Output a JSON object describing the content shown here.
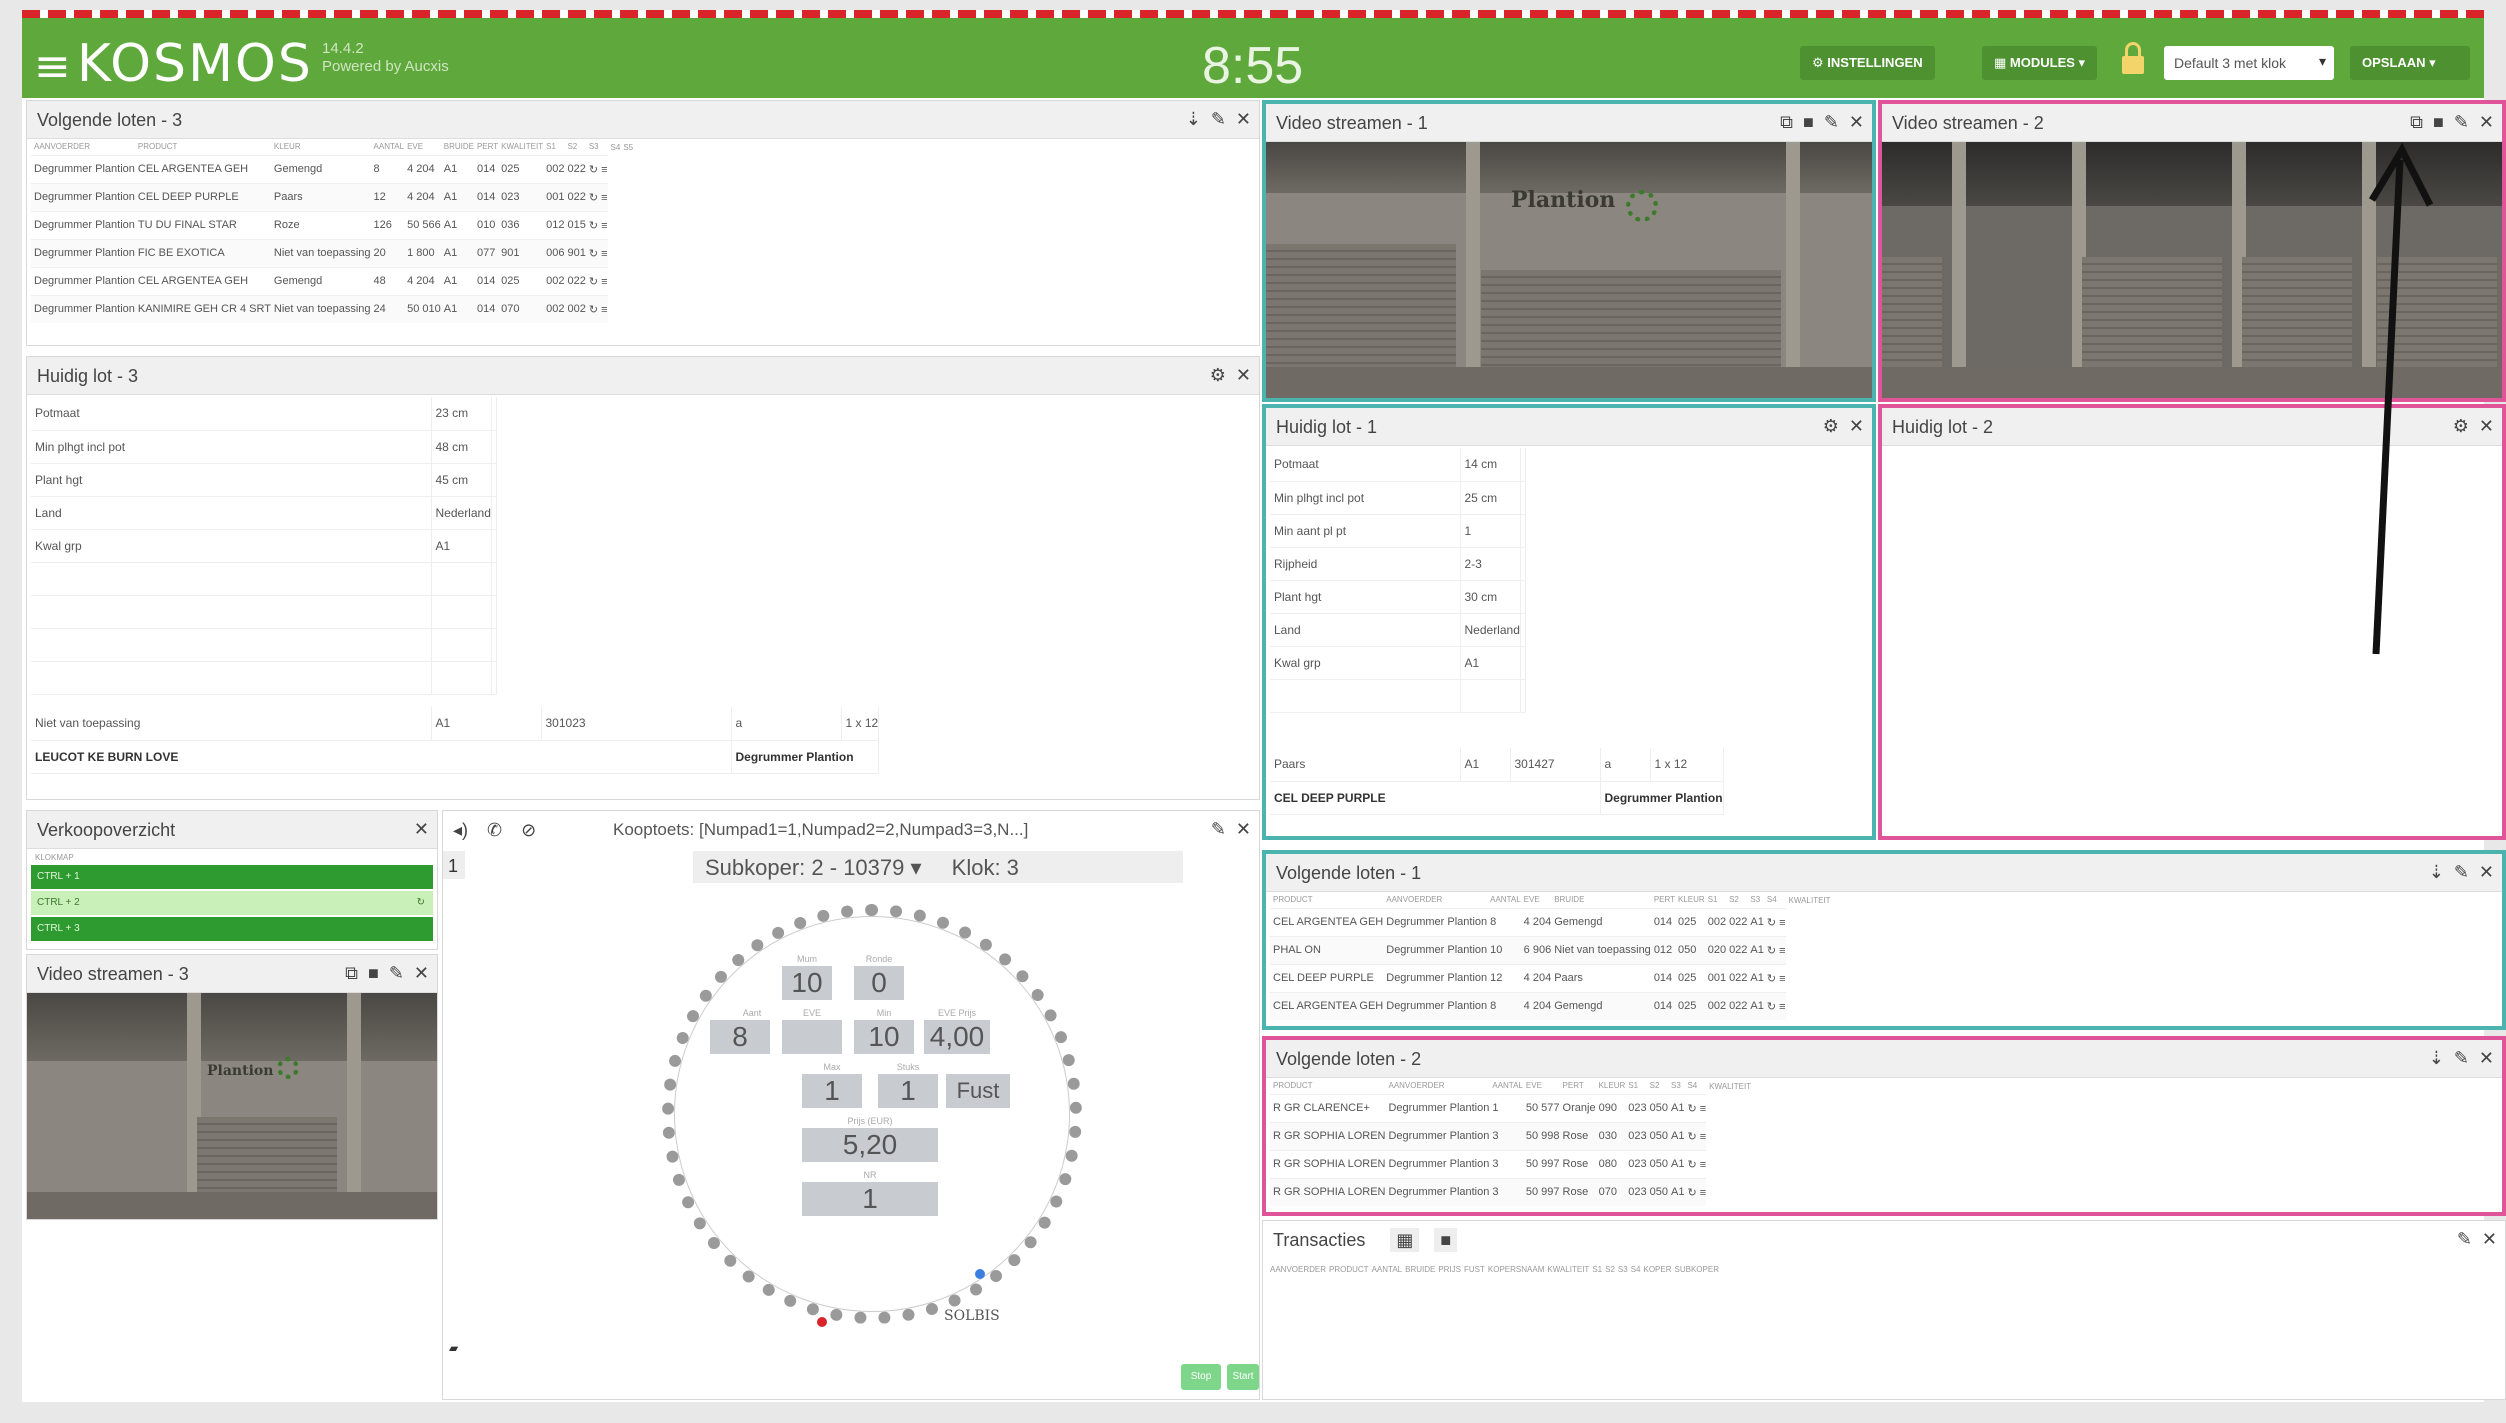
{
  "app": {
    "logo": "KOSMOS",
    "version": "14.4.2",
    "powered": "Powered by Aucxis",
    "clock": "8:55",
    "settings_btn": "INSTELLINGEN",
    "modules_btn": "MODULES",
    "layout_select": "Default 3 met klok",
    "save_btn": "OPSLAAN"
  },
  "vl3": {
    "title": "Volgende loten - 3",
    "headers": [
      "AANVOERDER",
      "PRODUCT",
      "KLEUR",
      "AANTAL",
      "EVE",
      "BRUIDE",
      "PERT",
      "KWALITEIT",
      "S1",
      "S2",
      "S3",
      "S4",
      "S5"
    ],
    "rows": [
      [
        "Degrummer Plantion",
        "CEL ARGENTEA GEH",
        "Gemengd",
        "8",
        "4 204",
        "A1",
        "014",
        "025",
        "002",
        "022"
      ],
      [
        "Degrummer Plantion",
        "CEL DEEP PURPLE",
        "Paars",
        "12",
        "4 204",
        "A1",
        "014",
        "023",
        "001",
        "022"
      ],
      [
        "Degrummer Plantion",
        "TU DU FINAL STAR",
        "Roze",
        "126",
        "50 566",
        "A1",
        "010",
        "036",
        "012",
        "015"
      ],
      [
        "Degrummer Plantion",
        "FIC BE EXOTICA",
        "Niet van toepassing",
        "20",
        "1 800",
        "A1",
        "077",
        "901",
        "006",
        "901"
      ],
      [
        "Degrummer Plantion",
        "CEL ARGENTEA GEH",
        "Gemengd",
        "48",
        "4 204",
        "A1",
        "014",
        "025",
        "002",
        "022"
      ],
      [
        "Degrummer Plantion",
        "KANIMIRE GEH CR 4 SRT",
        "Niet van toepassing",
        "24",
        "50 010",
        "A1",
        "014",
        "070",
        "002",
        "002"
      ]
    ]
  },
  "hl3": {
    "title": "Huidig lot - 3",
    "rows": [
      [
        "Potmaat",
        "23 cm"
      ],
      [
        "Min plhgt incl pot",
        "48 cm"
      ],
      [
        "Plant hgt",
        "45 cm"
      ],
      [
        "Land",
        "Nederland"
      ],
      [
        "Kwal grp",
        "A1"
      ],
      [
        "",
        ""
      ],
      [
        "",
        ""
      ],
      [
        "",
        ""
      ],
      [
        "",
        ""
      ]
    ],
    "bottom": [
      "Niet van toepassing",
      "A1",
      "301023",
      "a",
      "1 x 12"
    ],
    "product": "LEUCOT KE BURN LOVE",
    "supplier": "Degrummer Plantion"
  },
  "vo": {
    "title": "Verkoopoverzicht",
    "sub": "KLOKMAP",
    "row1": "CTRL + 1",
    "row2": "CTRL + 2",
    "row3": "CTRL + 3"
  },
  "vs3": {
    "title": "Video streamen - 3",
    "sign": "Plantion"
  },
  "klok": {
    "title": "Kooptoets: [Numpad1=1,Numpad2=2,Numpad3=3,N...]",
    "num": "1",
    "subkoper": "Subkoper: 2 - 10379",
    "klok": "Klok: 3",
    "brand": "SOLBIS",
    "lbl": {
      "mum": "Mum",
      "ronde": "Ronde",
      "aant": "Aant",
      "eve": "EVE",
      "min": "Min",
      "eve_prijs": "EVE Prijs",
      "max": "Max",
      "stuks": "Stuks",
      "prijs": "Prijs (EUR)",
      "nr": "NR"
    },
    "v": {
      "mum": "10",
      "ronde": "0",
      "aant": "8",
      "eve": "",
      "min": "10",
      "eve_prijs": "4,00",
      "max": "1",
      "stuks": "1",
      "fust": "Fust",
      "prijs": "5,20",
      "nr": "1"
    },
    "btn1": "Stop",
    "btn2": "Start"
  },
  "vs1": {
    "title": "Video streamen - 1",
    "sign": "Plantion"
  },
  "vs2": {
    "title": "Video streamen - 2"
  },
  "hl1": {
    "title": "Huidig lot - 1",
    "rows": [
      [
        "Potmaat",
        "14 cm"
      ],
      [
        "Min plhgt incl pot",
        "25 cm"
      ],
      [
        "Min aant pl pt",
        "1"
      ],
      [
        "Rijpheid",
        "2-3"
      ],
      [
        "Plant hgt",
        "30 cm"
      ],
      [
        "Land",
        "Nederland"
      ],
      [
        "Kwal grp",
        "A1"
      ],
      [
        "",
        ""
      ]
    ],
    "bottom": [
      "Paars",
      "A1",
      "301427",
      "a",
      "1 x 12"
    ],
    "product": "CEL DEEP PURPLE",
    "supplier": "Degrummer Plantion"
  },
  "hl2": {
    "title": "Huidig lot - 2"
  },
  "vl1": {
    "title": "Volgende loten - 1",
    "headers": [
      "PRODUCT",
      "AANVOERDER",
      "AANTAL",
      "EVE",
      "BRUIDE",
      "PERT",
      "KLEUR",
      "S1",
      "S2",
      "S3",
      "S4",
      "KWALITEIT"
    ],
    "rows": [
      [
        "CEL ARGENTEA GEH",
        "Degrummer Plantion",
        "8",
        "4 204",
        "Gemengd",
        "014",
        "025",
        "002",
        "022",
        "A1"
      ],
      [
        "PHAL ON",
        "Degrummer Plantion",
        "10",
        "6 906",
        "Niet van toepassing",
        "012",
        "050",
        "020",
        "022",
        "A1"
      ],
      [
        "CEL DEEP PURPLE",
        "Degrummer Plantion",
        "12",
        "4 204",
        "Paars",
        "014",
        "025",
        "001",
        "022",
        "A1"
      ],
      [
        "CEL ARGENTEA GEH",
        "Degrummer Plantion",
        "8",
        "4 204",
        "Gemengd",
        "014",
        "025",
        "002",
        "022",
        "A1"
      ]
    ]
  },
  "vl2": {
    "title": "Volgende loten - 2",
    "headers": [
      "PRODUCT",
      "AANVOERDER",
      "AANTAL",
      "EVE",
      "PERT",
      "KLEUR",
      "S1",
      "S2",
      "S3",
      "S4",
      "KWALITEIT"
    ],
    "rows": [
      [
        "R GR CLARENCE+",
        "Degrummer Plantion",
        "1",
        "50 577",
        "Oranje",
        "090",
        "023",
        "050",
        "A1"
      ],
      [
        "R GR SOPHIA LOREN",
        "Degrummer Plantion",
        "3",
        "50 998",
        "Rose",
        "030",
        "023",
        "050",
        "A1"
      ],
      [
        "R GR SOPHIA LOREN",
        "Degrummer Plantion",
        "3",
        "50 997",
        "Rose",
        "080",
        "023",
        "050",
        "A1"
      ],
      [
        "R GR SOPHIA LOREN",
        "Degrummer Plantion",
        "3",
        "50 997",
        "Rose",
        "070",
        "023",
        "050",
        "A1"
      ]
    ]
  },
  "tr": {
    "title": "Transacties",
    "headers": [
      "AANVOERDER",
      "PRODUCT",
      "AANTAL",
      "BRUIDE",
      "PRIJS",
      "FUST",
      "KOPERSNAAM",
      "KWALITEIT",
      "S1",
      "S2",
      "S3",
      "S4",
      "KOPER",
      "SUBKOPER"
    ]
  }
}
